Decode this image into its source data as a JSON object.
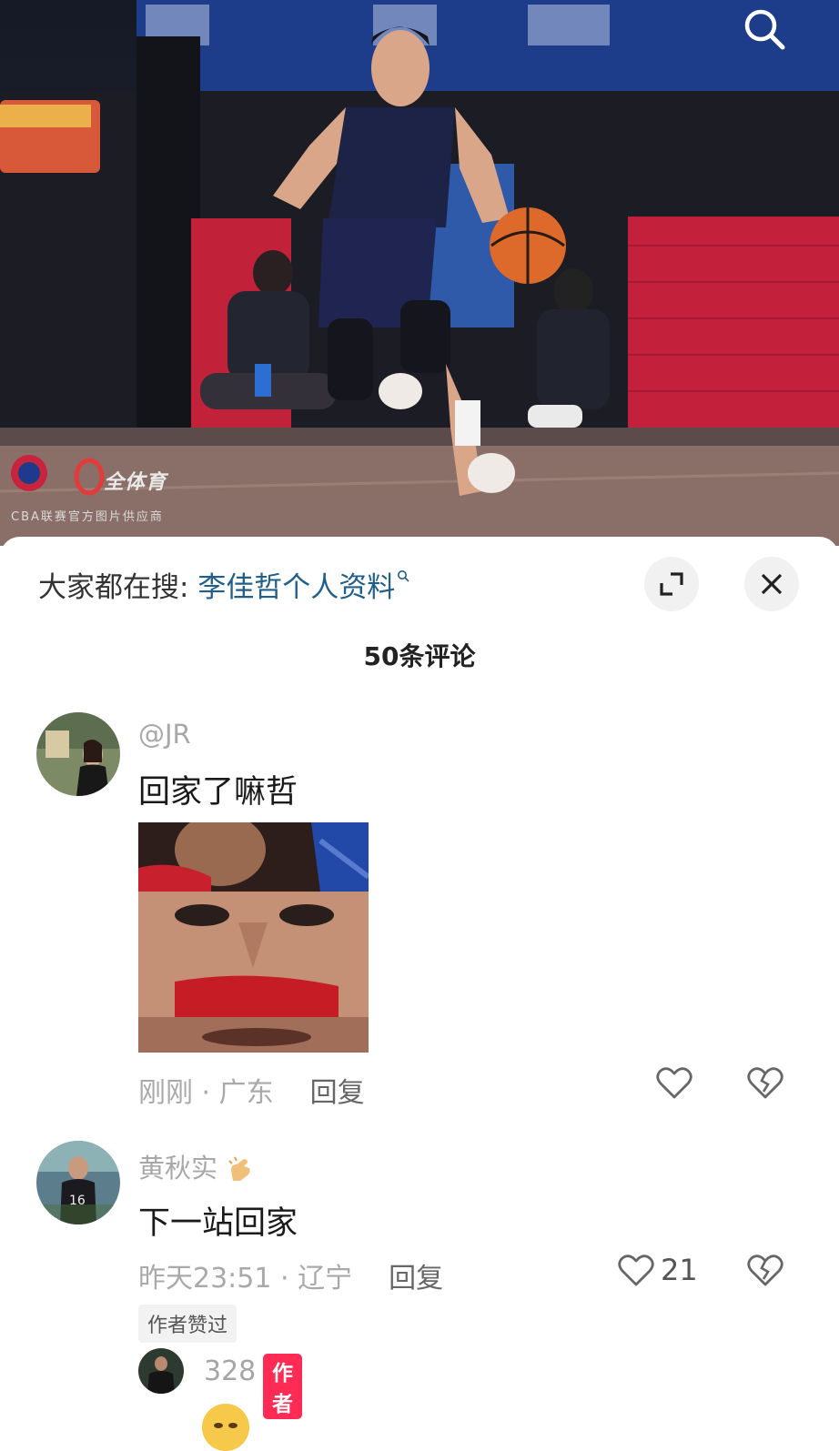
{
  "hero": {
    "watermark_brand": "全体育",
    "watermark_caption": "CBA联赛官方图片供应商",
    "icons": [
      "search-icon"
    ]
  },
  "search": {
    "prefix": "大家都在搜:",
    "keyword": "李佳哲个人资料",
    "icon": "search-icon"
  },
  "header": {
    "comment_count": "50条评论",
    "expand_icon": "expand-icon",
    "close_icon": "close-icon"
  },
  "comments": [
    {
      "username": "@JR",
      "text": "回家了嘛哲",
      "time": "刚刚",
      "location": "广东",
      "meta": "刚刚 · 广东",
      "reply_label": "回复",
      "likes": "",
      "has_image": true
    },
    {
      "username": "黄秋实",
      "text": "下一站回家",
      "time": "昨天23:51",
      "location": "辽宁",
      "meta": "昨天23:51 · 辽宁",
      "reply_label": "回复",
      "likes": "21",
      "author_liked": "作者赞过",
      "reply": {
        "username": "328",
        "badge": "作者"
      }
    }
  ],
  "colors": {
    "accent_keyword": "#1f5f8a",
    "author_badge": "#fe2c55",
    "background": "#ffffff"
  }
}
